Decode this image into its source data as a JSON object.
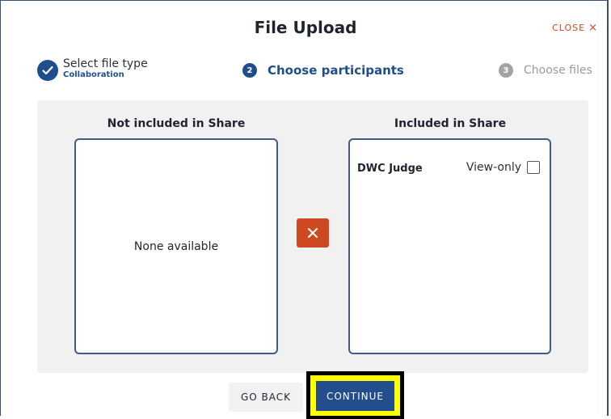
{
  "dialog": {
    "title": "File Upload",
    "close_label": "CLOSE",
    "close_icon": "×"
  },
  "steps": [
    {
      "number": "",
      "label": "Select file type",
      "sublabel": "Collaboration",
      "state": "complete"
    },
    {
      "number": "2",
      "label": "Choose participants",
      "state": "active"
    },
    {
      "number": "3",
      "label": "Choose files",
      "state": "inactive"
    }
  ],
  "not_included": {
    "title": "Not included in Share",
    "empty_text": "None available"
  },
  "included": {
    "title": "Included in Share",
    "participants": [
      {
        "name": "DWC Judge",
        "view_only_label": "View-only",
        "view_only_checked": false
      }
    ]
  },
  "footer": {
    "go_back_label": "GO BACK",
    "continue_label": "CONTINUE"
  },
  "colors": {
    "primary": "#1e4f8c",
    "danger": "#cc4a1e",
    "highlight": "#ffff00"
  }
}
